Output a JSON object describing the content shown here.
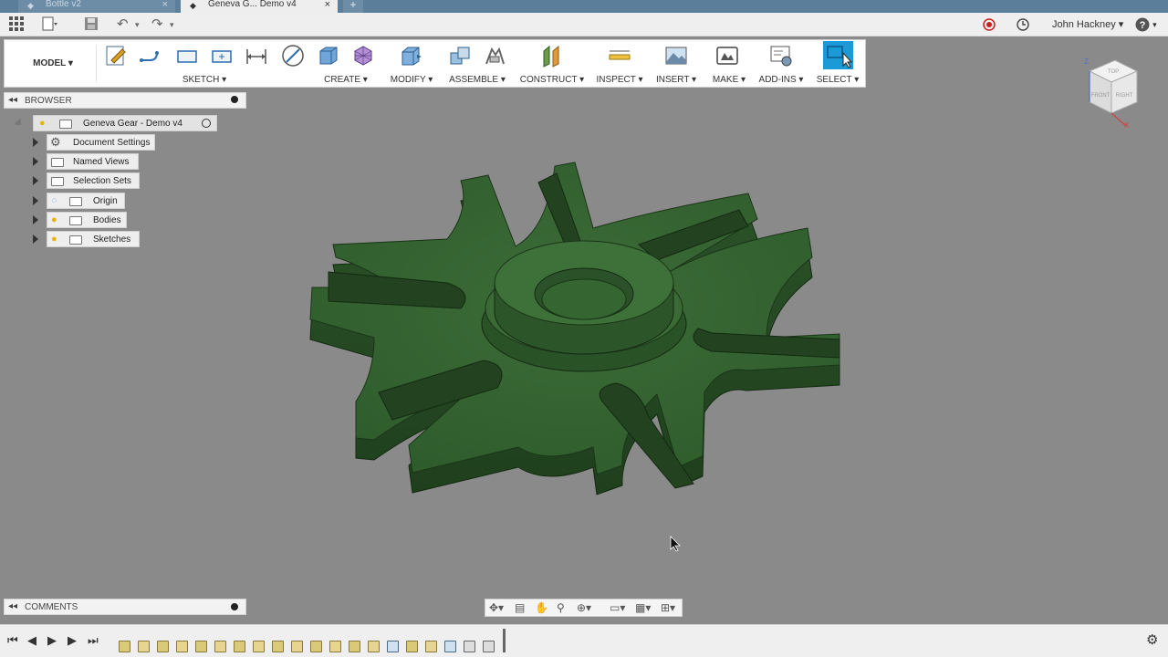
{
  "tabs": [
    {
      "label": "Bottle v2",
      "active": false
    },
    {
      "label": "Geneva G... Demo v4",
      "active": true
    }
  ],
  "user": {
    "name": "John Hackney"
  },
  "toolbar": {
    "model_label": "MODEL",
    "groups": [
      {
        "label": "SKETCH"
      },
      {
        "label": "CREATE"
      },
      {
        "label": "MODIFY"
      },
      {
        "label": "ASSEMBLE"
      },
      {
        "label": "CONSTRUCT"
      },
      {
        "label": "INSPECT"
      },
      {
        "label": "INSERT"
      },
      {
        "label": "MAKE"
      },
      {
        "label": "ADD-INS"
      },
      {
        "label": "SELECT"
      }
    ]
  },
  "browser": {
    "title": "BROWSER",
    "root": "Geneva Gear - Demo v4",
    "items": [
      {
        "label": "Document Settings",
        "icon": "gear-icon"
      },
      {
        "label": "Named Views",
        "icon": "folder-icon"
      },
      {
        "label": "Selection Sets",
        "icon": "folder-icon"
      },
      {
        "label": "Origin",
        "icon": "folder-icon"
      },
      {
        "label": "Bodies",
        "icon": "folder-icon"
      },
      {
        "label": "Sketches",
        "icon": "folder-icon"
      }
    ]
  },
  "comments": {
    "title": "COMMENTS"
  },
  "viewcube": {
    "top": "TOP",
    "front": "FRONT",
    "right": "RIGHT",
    "axis_z": "Z",
    "axis_x": "X"
  },
  "colors": {
    "model": "#2f5c2c",
    "viewport": "#8a8a8a",
    "accent": "#1a9ad6"
  }
}
